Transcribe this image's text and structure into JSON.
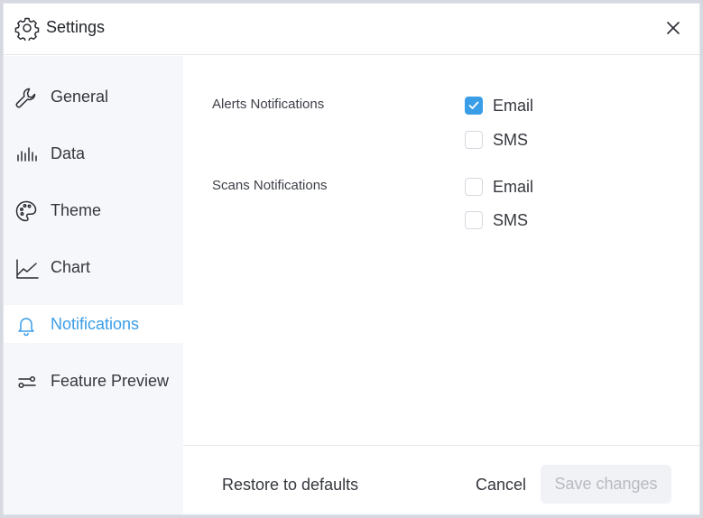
{
  "window": {
    "title": "Settings",
    "title_icon": "gear-icon",
    "close_icon": "close-icon"
  },
  "sidebar": {
    "active_index": 4,
    "items": [
      {
        "label": "General",
        "icon": "wrench-icon"
      },
      {
        "label": "Data",
        "icon": "bar-chart-icon"
      },
      {
        "label": "Theme",
        "icon": "palette-icon"
      },
      {
        "label": "Chart",
        "icon": "line-chart-icon"
      },
      {
        "label": "Notifications",
        "icon": "bell-icon"
      },
      {
        "label": "Feature Preview",
        "icon": "sliders-icon"
      }
    ]
  },
  "notifications": {
    "groups": [
      {
        "label": "Alerts Notifications",
        "options": [
          {
            "label": "Email",
            "checked": true
          },
          {
            "label": "SMS",
            "checked": false
          }
        ]
      },
      {
        "label": "Scans Notifications",
        "options": [
          {
            "label": "Email",
            "checked": false
          },
          {
            "label": "SMS",
            "checked": false
          }
        ]
      }
    ]
  },
  "footer": {
    "restore_label": "Restore to defaults",
    "cancel_label": "Cancel",
    "save_label": "Save changes",
    "save_enabled": false
  },
  "colors": {
    "accent": "#3a9de8",
    "sidebar_bg": "#f6f7fb",
    "disabled_text": "#b7bac2"
  }
}
